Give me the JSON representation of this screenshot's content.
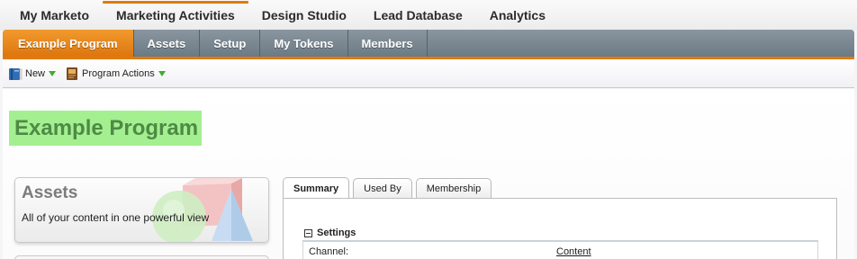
{
  "top_nav": {
    "items": [
      "My Marketo",
      "Marketing Activities",
      "Design Studio",
      "Lead Database",
      "Analytics"
    ],
    "active": "Marketing Activities"
  },
  "program_tabs": {
    "items": [
      "Example Program",
      "Assets",
      "Setup",
      "My Tokens",
      "Members"
    ],
    "active": "Example Program"
  },
  "toolbar": {
    "new_label": "New",
    "program_actions_label": "Program Actions"
  },
  "page": {
    "title": "Example Program"
  },
  "assets_card": {
    "title": "Assets",
    "description": "All of your content in one powerful view"
  },
  "panel_tabs": {
    "items": [
      "Summary",
      "Used By",
      "Membership"
    ],
    "active": "Summary"
  },
  "settings": {
    "heading": "Settings",
    "rows": [
      {
        "label": "Channel:",
        "value": "Content"
      }
    ]
  },
  "colors": {
    "accent_orange": "#e07b10",
    "tab_bar_gray": "#6b7a85",
    "title_highlight": "#a4f091",
    "title_text": "#4e8a45",
    "dropdown_arrow_green": "#3fae2a"
  },
  "icons": {
    "new": "blue-book-icon",
    "program_actions": "program-book-icon",
    "dropdown": "green-triangle-down-icon",
    "collapse": "collapse-minus-icon"
  }
}
